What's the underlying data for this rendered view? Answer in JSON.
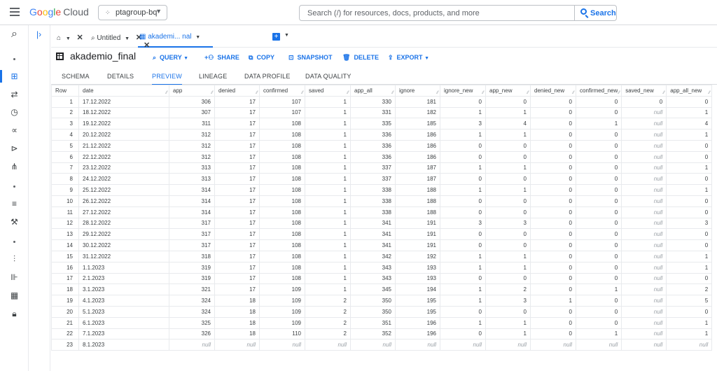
{
  "header": {
    "logo_letters": [
      "G",
      "o",
      "o",
      "g",
      "l",
      "e"
    ],
    "logo_suffix": "Cloud",
    "project": "ptagroup-bq",
    "search_placeholder": "Search (/) for resources, docs, products, and more",
    "search_button": "Search"
  },
  "tabs": {
    "untitled": "Untitled",
    "active": "akademi... nal"
  },
  "dataset": {
    "title": "akademio_final",
    "toolbar": {
      "query": "QUERY",
      "share": "SHARE",
      "copy": "COPY",
      "snapshot": "SNAPSHOT",
      "delete": "DELETE",
      "export": "EXPORT"
    }
  },
  "subtabs": [
    "SCHEMA",
    "DETAILS",
    "PREVIEW",
    "LINEAGE",
    "DATA PROFILE",
    "DATA QUALITY"
  ],
  "table": {
    "columns": [
      "Row",
      "date",
      "app",
      "denied",
      "confirmed",
      "saved",
      "app_all",
      "ignore",
      "ignore_new",
      "app_new",
      "denied_new",
      "confirmed_new",
      "saved_new",
      "app_all_new"
    ],
    "rows": [
      [
        "1",
        "17.12.2022",
        "306",
        "17",
        "107",
        "1",
        "330",
        "181",
        "0",
        "0",
        "0",
        "0",
        "0",
        "0"
      ],
      [
        "2",
        "18.12.2022",
        "307",
        "17",
        "107",
        "1",
        "331",
        "182",
        "1",
        "1",
        "0",
        "0",
        "null",
        "1"
      ],
      [
        "3",
        "19.12.2022",
        "311",
        "17",
        "108",
        "1",
        "335",
        "185",
        "3",
        "4",
        "0",
        "1",
        "null",
        "4"
      ],
      [
        "4",
        "20.12.2022",
        "312",
        "17",
        "108",
        "1",
        "336",
        "186",
        "1",
        "1",
        "0",
        "0",
        "null",
        "1"
      ],
      [
        "5",
        "21.12.2022",
        "312",
        "17",
        "108",
        "1",
        "336",
        "186",
        "0",
        "0",
        "0",
        "0",
        "null",
        "0"
      ],
      [
        "6",
        "22.12.2022",
        "312",
        "17",
        "108",
        "1",
        "336",
        "186",
        "0",
        "0",
        "0",
        "0",
        "null",
        "0"
      ],
      [
        "7",
        "23.12.2022",
        "313",
        "17",
        "108",
        "1",
        "337",
        "187",
        "1",
        "1",
        "0",
        "0",
        "null",
        "1"
      ],
      [
        "8",
        "24.12.2022",
        "313",
        "17",
        "108",
        "1",
        "337",
        "187",
        "0",
        "0",
        "0",
        "0",
        "null",
        "0"
      ],
      [
        "9",
        "25.12.2022",
        "314",
        "17",
        "108",
        "1",
        "338",
        "188",
        "1",
        "1",
        "0",
        "0",
        "null",
        "1"
      ],
      [
        "10",
        "26.12.2022",
        "314",
        "17",
        "108",
        "1",
        "338",
        "188",
        "0",
        "0",
        "0",
        "0",
        "null",
        "0"
      ],
      [
        "11",
        "27.12.2022",
        "314",
        "17",
        "108",
        "1",
        "338",
        "188",
        "0",
        "0",
        "0",
        "0",
        "null",
        "0"
      ],
      [
        "12",
        "28.12.2022",
        "317",
        "17",
        "108",
        "1",
        "341",
        "191",
        "3",
        "3",
        "0",
        "0",
        "null",
        "3"
      ],
      [
        "13",
        "29.12.2022",
        "317",
        "17",
        "108",
        "1",
        "341",
        "191",
        "0",
        "0",
        "0",
        "0",
        "null",
        "0"
      ],
      [
        "14",
        "30.12.2022",
        "317",
        "17",
        "108",
        "1",
        "341",
        "191",
        "0",
        "0",
        "0",
        "0",
        "null",
        "0"
      ],
      [
        "15",
        "31.12.2022",
        "318",
        "17",
        "108",
        "1",
        "342",
        "192",
        "1",
        "1",
        "0",
        "0",
        "null",
        "1"
      ],
      [
        "16",
        "1.1.2023",
        "319",
        "17",
        "108",
        "1",
        "343",
        "193",
        "1",
        "1",
        "0",
        "0",
        "null",
        "1"
      ],
      [
        "17",
        "2.1.2023",
        "319",
        "17",
        "108",
        "1",
        "343",
        "193",
        "0",
        "0",
        "0",
        "0",
        "null",
        "0"
      ],
      [
        "18",
        "3.1.2023",
        "321",
        "17",
        "109",
        "1",
        "345",
        "194",
        "1",
        "2",
        "0",
        "1",
        "null",
        "2"
      ],
      [
        "19",
        "4.1.2023",
        "324",
        "18",
        "109",
        "2",
        "350",
        "195",
        "1",
        "3",
        "1",
        "0",
        "null",
        "5"
      ],
      [
        "20",
        "5.1.2023",
        "324",
        "18",
        "109",
        "2",
        "350",
        "195",
        "0",
        "0",
        "0",
        "0",
        "null",
        "0"
      ],
      [
        "21",
        "6.1.2023",
        "325",
        "18",
        "109",
        "2",
        "351",
        "196",
        "1",
        "1",
        "0",
        "0",
        "null",
        "1"
      ],
      [
        "22",
        "7.1.2023",
        "326",
        "18",
        "110",
        "2",
        "352",
        "196",
        "0",
        "1",
        "0",
        "1",
        "null",
        "1"
      ],
      [
        "23",
        "8.1.2023",
        "null",
        "null",
        "null",
        "null",
        "null",
        "null",
        "null",
        "null",
        "null",
        "null",
        "null",
        "null"
      ]
    ]
  }
}
